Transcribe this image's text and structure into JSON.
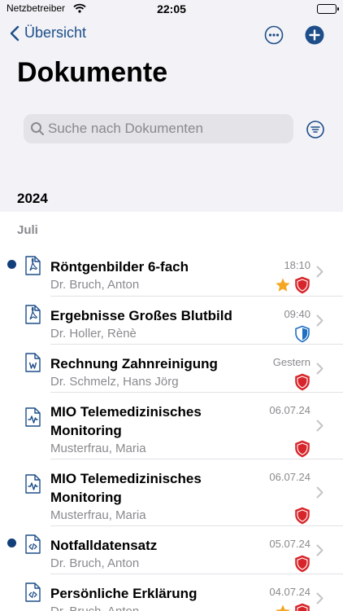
{
  "status": {
    "carrier": "Netzbetreiber",
    "time": "22:05"
  },
  "nav": {
    "back_label": "Übersicht"
  },
  "page": {
    "title": "Dokumente"
  },
  "search": {
    "placeholder": "Suche nach Dokumenten"
  },
  "section": {
    "year": "2024",
    "month": "Juli"
  },
  "documents": [
    {
      "title": "Röntgenbilder 6-fach",
      "author": "Dr. Bruch, Anton",
      "time": "18:10",
      "icon": "pdf-icon",
      "unread": true,
      "favorite": true,
      "shield": "red-shield-icon"
    },
    {
      "title": "Ergebnisse Großes Blutbild",
      "author": "Dr. Holler, Rènè",
      "time": "09:40",
      "icon": "pdf-icon",
      "unread": false,
      "favorite": false,
      "shield": "blue-shield-icon"
    },
    {
      "title": "Rechnung Zahnreinigung",
      "author": "Dr. Schmelz, Hans Jörg",
      "time": "Gestern",
      "icon": "word-document-icon",
      "unread": false,
      "favorite": false,
      "shield": "red-shield-icon"
    },
    {
      "title": "MIO Telemedizinisches Monitoring",
      "author": "Musterfrau, Maria",
      "time": "06.07.24",
      "icon": "monitoring-document-icon",
      "unread": false,
      "favorite": false,
      "shield": "red-shield-icon"
    },
    {
      "title": "MIO Telemedizinisches Monitoring",
      "author": "Musterfrau, Maria",
      "time": "06.07.24",
      "icon": "monitoring-document-icon",
      "unread": false,
      "favorite": false,
      "shield": "red-shield-icon"
    },
    {
      "title": "Notfalldatensatz",
      "author": "Dr. Bruch, Anton",
      "time": "05.07.24",
      "icon": "code-document-icon",
      "unread": true,
      "favorite": false,
      "shield": "red-shield-icon"
    },
    {
      "title": "Persönliche Erklärung",
      "author": "Dr. Bruch, Anton",
      "time": "04.07.24",
      "icon": "code-document-icon",
      "unread": false,
      "favorite": true,
      "shield": "red-shield-icon"
    }
  ],
  "colors": {
    "accent": "#1d4e89",
    "unread_dot": "#123f7a",
    "shield_red": "#d7262b",
    "shield_blue": "#1f6fc4",
    "star": "#f5a623"
  }
}
